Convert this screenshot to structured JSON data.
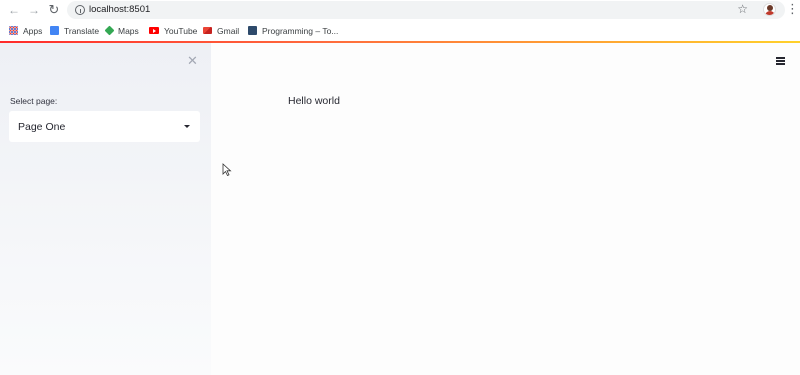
{
  "browser": {
    "url": "localhost:8501",
    "bookmarks": [
      {
        "label": "Apps",
        "icon": "apps-icon"
      },
      {
        "label": "Translate",
        "icon": "translate-icon"
      },
      {
        "label": "Maps",
        "icon": "maps-icon"
      },
      {
        "label": "YouTube",
        "icon": "youtube-icon"
      },
      {
        "label": "Gmail",
        "icon": "gmail-icon"
      },
      {
        "label": "Programming – To...",
        "icon": "programming-icon"
      }
    ]
  },
  "sidebar": {
    "select_label": "Select page:",
    "select_value": "Page One"
  },
  "main": {
    "content": "Hello world"
  },
  "colors": {
    "accent_start": "#ff2b2b",
    "accent_end": "#ffd12b",
    "sidebar_bg": "#eef0f5"
  }
}
